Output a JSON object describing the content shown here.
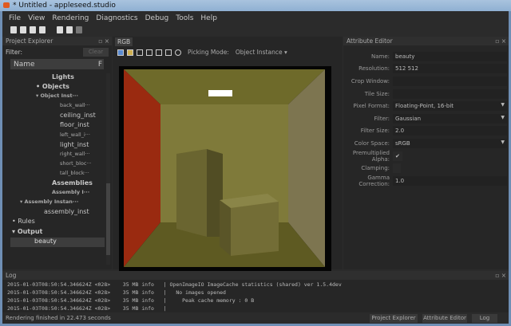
{
  "window": {
    "title": "* Untitled - appleseed.studio"
  },
  "menu": [
    "File",
    "View",
    "Rendering",
    "Diagnostics",
    "Debug",
    "Tools",
    "Help"
  ],
  "project_explorer": {
    "title": "Project Explorer",
    "filter_label": "Filter:",
    "clear_label": "Clear",
    "column": "Name",
    "column2": "F",
    "items": [
      {
        "label": "Lights",
        "indent": 52,
        "cls": "b",
        "arrow": ""
      },
      {
        "label": "Objects",
        "indent": 42,
        "cls": "b",
        "arrow": "•"
      },
      {
        "label": "Object Inst···",
        "indent": 42,
        "cls": "s b",
        "arrow": "▾"
      },
      {
        "label": "back_wall···",
        "indent": 62,
        "cls": "s",
        "arrow": ""
      },
      {
        "label": "ceiling_inst",
        "indent": 62,
        "cls": "",
        "arrow": ""
      },
      {
        "label": "floor_inst",
        "indent": 62,
        "cls": "",
        "arrow": ""
      },
      {
        "label": "left_wall_i···",
        "indent": 62,
        "cls": "s",
        "arrow": ""
      },
      {
        "label": "light_inst",
        "indent": 62,
        "cls": "",
        "arrow": ""
      },
      {
        "label": "right_wall···",
        "indent": 62,
        "cls": "s",
        "arrow": ""
      },
      {
        "label": "short_bloc···",
        "indent": 62,
        "cls": "s",
        "arrow": ""
      },
      {
        "label": "tall_block···",
        "indent": 62,
        "cls": "s",
        "arrow": ""
      },
      {
        "label": "Assemblies",
        "indent": 52,
        "cls": "b",
        "arrow": ""
      },
      {
        "label": "Assembly I···",
        "indent": 52,
        "cls": "s b",
        "arrow": ""
      },
      {
        "label": "Assembly Instan···",
        "indent": 22,
        "cls": "s b",
        "arrow": "▾"
      },
      {
        "label": "assembly_inst",
        "indent": 42,
        "cls": "",
        "arrow": ""
      },
      {
        "label": "Rules",
        "indent": 12,
        "cls": "",
        "arrow": "•"
      },
      {
        "label": "Output",
        "indent": 12,
        "cls": "b",
        "arrow": "▾"
      },
      {
        "label": "beauty",
        "indent": 30,
        "cls": "sel",
        "arrow": ""
      }
    ]
  },
  "viewer": {
    "tab": "RGB",
    "picking_label": "Picking Mode:",
    "picking_value": "Object Instance"
  },
  "attribute_editor": {
    "title": "Attribute Editor",
    "rows": [
      {
        "label": "Name:",
        "value": "beauty",
        "dropdown": false
      },
      {
        "label": "Resolution:",
        "value": "512 512",
        "dropdown": false
      },
      {
        "label": "Crop Window:",
        "value": "",
        "dropdown": false
      },
      {
        "label": "Tile Size:",
        "value": "",
        "dropdown": false
      },
      {
        "label": "Pixel Format:",
        "value": "Floating-Point, 16-bit",
        "dropdown": true
      },
      {
        "label": "Filter:",
        "value": "Gaussian",
        "dropdown": true
      },
      {
        "label": "Filter Size:",
        "value": "2.0",
        "dropdown": false
      },
      {
        "label": "Color Space:",
        "value": "sRGB",
        "dropdown": true
      },
      {
        "label": "Premultiplied Alpha:",
        "value": "✔",
        "dropdown": false
      },
      {
        "label": "Clamping:",
        "value": "",
        "dropdown": false
      },
      {
        "label": "Gamma Correction:",
        "value": "1.0",
        "dropdown": false
      }
    ]
  },
  "log": {
    "title": "Log",
    "lines": [
      "2015-01-03T08:50:54.346624Z <028>    35 MB info   | OpenImageIO ImageCache statistics (shared) ver 1.5.4dev",
      "2015-01-03T08:50:54.346624Z <028>    35 MB info   |   No images opened",
      "2015-01-03T08:50:54.346624Z <028>    35 MB info   |     Peak cache memory : 0 B",
      "2015-01-03T08:50:54.346624Z <028>    35 MB info   |"
    ]
  },
  "status": {
    "text": "Rendering finished in 22.473 seconds",
    "buttons": [
      "Project Explorer",
      "Attribute Editor",
      "Log"
    ]
  }
}
